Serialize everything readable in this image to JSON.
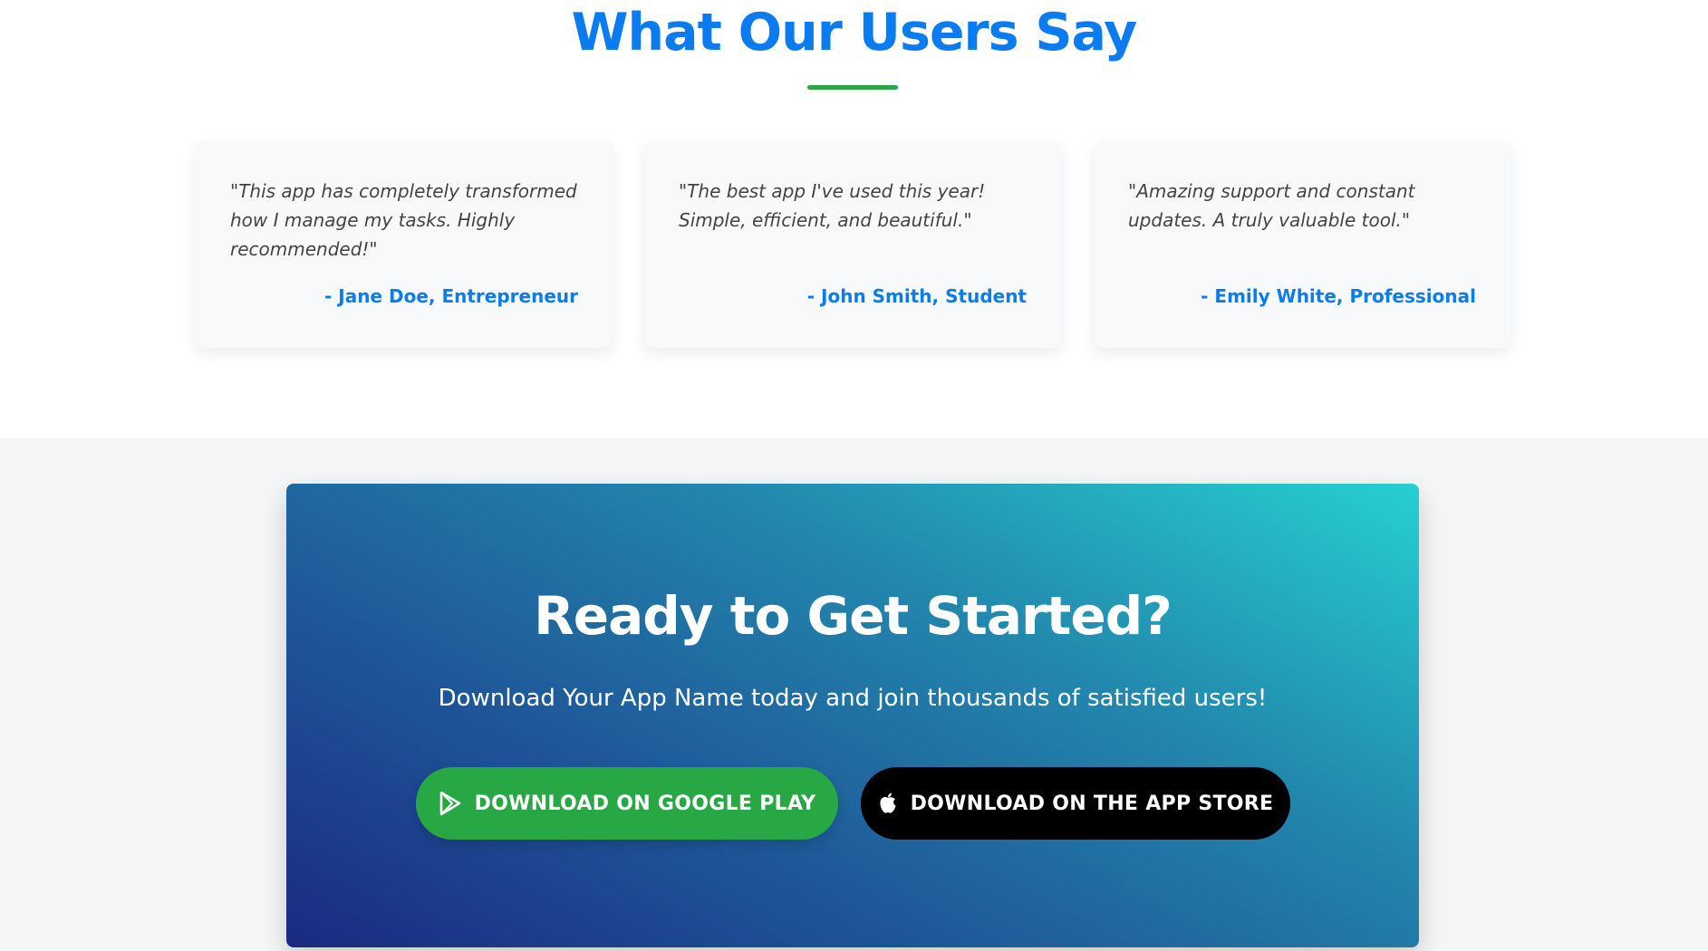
{
  "testimonials": {
    "title": "What Our Users Say",
    "accent_color": "#0a7cf0",
    "underline_color": "#28a745",
    "items": [
      {
        "quote": "\"This app has completely transformed how I manage my tasks. Highly recommended!\"",
        "author": "- Jane Doe, Entrepreneur"
      },
      {
        "quote": "\"The best app I've used this year! Simple, efficient, and beautiful.\"",
        "author": "- John Smith, Student"
      },
      {
        "quote": "\"Amazing support and constant updates. A truly valuable tool.\"",
        "author": "- Emily White, Professional"
      }
    ]
  },
  "cta": {
    "title": "Ready to Get Started?",
    "subtitle": "Download Your App Name today and join thousands of satisfied users!",
    "buttons": {
      "google_play": {
        "label": "DOWNLOAD ON GOOGLE PLAY",
        "icon": "google-play-icon",
        "color": "#28a745"
      },
      "app_store": {
        "label": "DOWNLOAD ON THE APP STORE",
        "icon": "apple-icon",
        "color": "#000000"
      }
    }
  }
}
